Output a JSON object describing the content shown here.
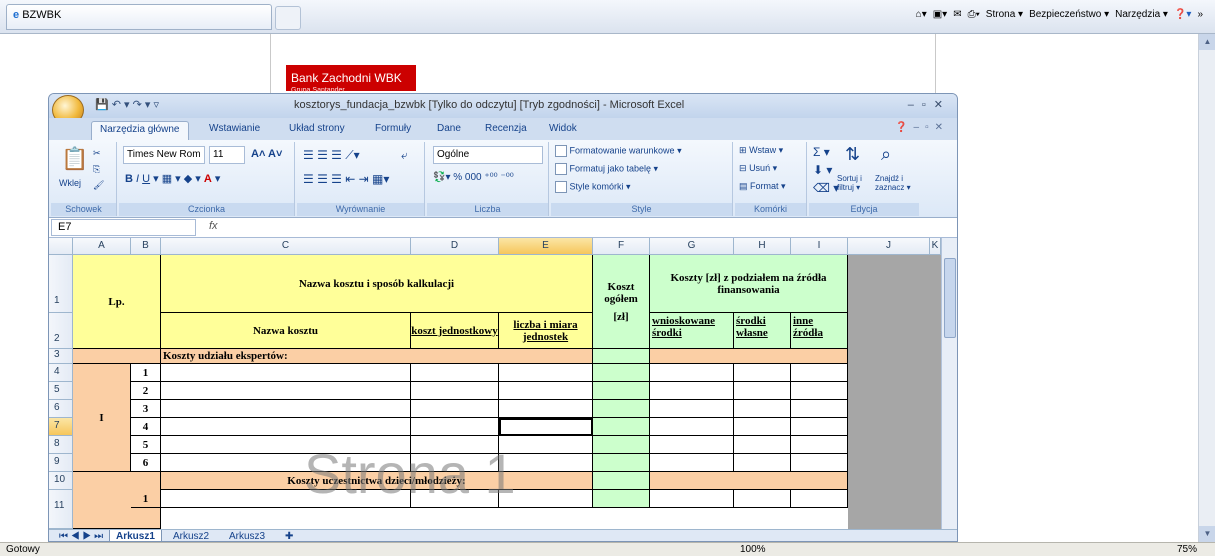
{
  "browser": {
    "tab_title": "BZWBK",
    "tools": [
      "Strona ▾",
      "Bezpieczeństwo ▾",
      "Narzędzia ▾"
    ],
    "status_left": "Gotowy",
    "zoom": "75%"
  },
  "bank_logo": {
    "name": "Bank Zachodni WBK",
    "sub": "Grupa Santander"
  },
  "excel": {
    "title": "kosztorys_fundacja_bzwbk  [Tylko do odczytu]  [Tryb zgodności] - Microsoft Excel",
    "office_button": "Office",
    "tabs": [
      "Narzędzia główne",
      "Wstawianie",
      "Układ strony",
      "Formuły",
      "Dane",
      "Recenzja",
      "Widok"
    ],
    "ribbon": {
      "paste": "Wklej",
      "font_name": "Times New Rom",
      "font_size": "11",
      "number_format": "Ogólne",
      "cond_format": "Formatowanie warunkowe ▾",
      "format_table": "Formatuj jako tabelę ▾",
      "cell_styles": "Style komórki ▾",
      "insert": "Wstaw ▾",
      "delete": "Usuń ▾",
      "format": "Format ▾",
      "sort": "Sortuj i filtruj ▾",
      "find": "Znajdź i zaznacz ▾",
      "groups": [
        "Schowek",
        "Czcionka",
        "Wyrównanie",
        "Liczba",
        "Style",
        "Komórki",
        "Edycja"
      ]
    },
    "name_box": "E7",
    "fx": "fx",
    "columns": [
      "A",
      "B",
      "C",
      "D",
      "E",
      "F",
      "G",
      "H",
      "I",
      "J",
      "K"
    ],
    "rows": [
      "1",
      "2",
      "3",
      "4",
      "5",
      "6",
      "7",
      "8",
      "9",
      "10",
      "11"
    ],
    "table": {
      "lp": "Lp.",
      "name_header": "Nazwa kosztu i sposób kalkulacji",
      "total_header": "Koszt ogółem",
      "total_unit": "[zł]",
      "sources_header": "Koszty [zł] z podziałem na źródła finansowania",
      "name_col": "Nazwa kosztu",
      "unit_cost": "koszt jednostkowy",
      "qty": "liczba i miara jednostek",
      "requested": "wnioskowane środki",
      "own": "środki własne",
      "other": "inne źródła",
      "section1": "Koszty udziału ekspertów:",
      "section1_roman": "I",
      "section1_rows": [
        "1",
        "2",
        "3",
        "4",
        "5",
        "6"
      ],
      "section2": "Koszty uczestnictwa dzieci/młodzieży:",
      "section2_rows": [
        "1"
      ]
    },
    "watermark": "Strona 1",
    "sheets": [
      "Arkusz1",
      "Arkusz2",
      "Arkusz3"
    ],
    "status": "Gotowy",
    "zoom": "100%"
  }
}
